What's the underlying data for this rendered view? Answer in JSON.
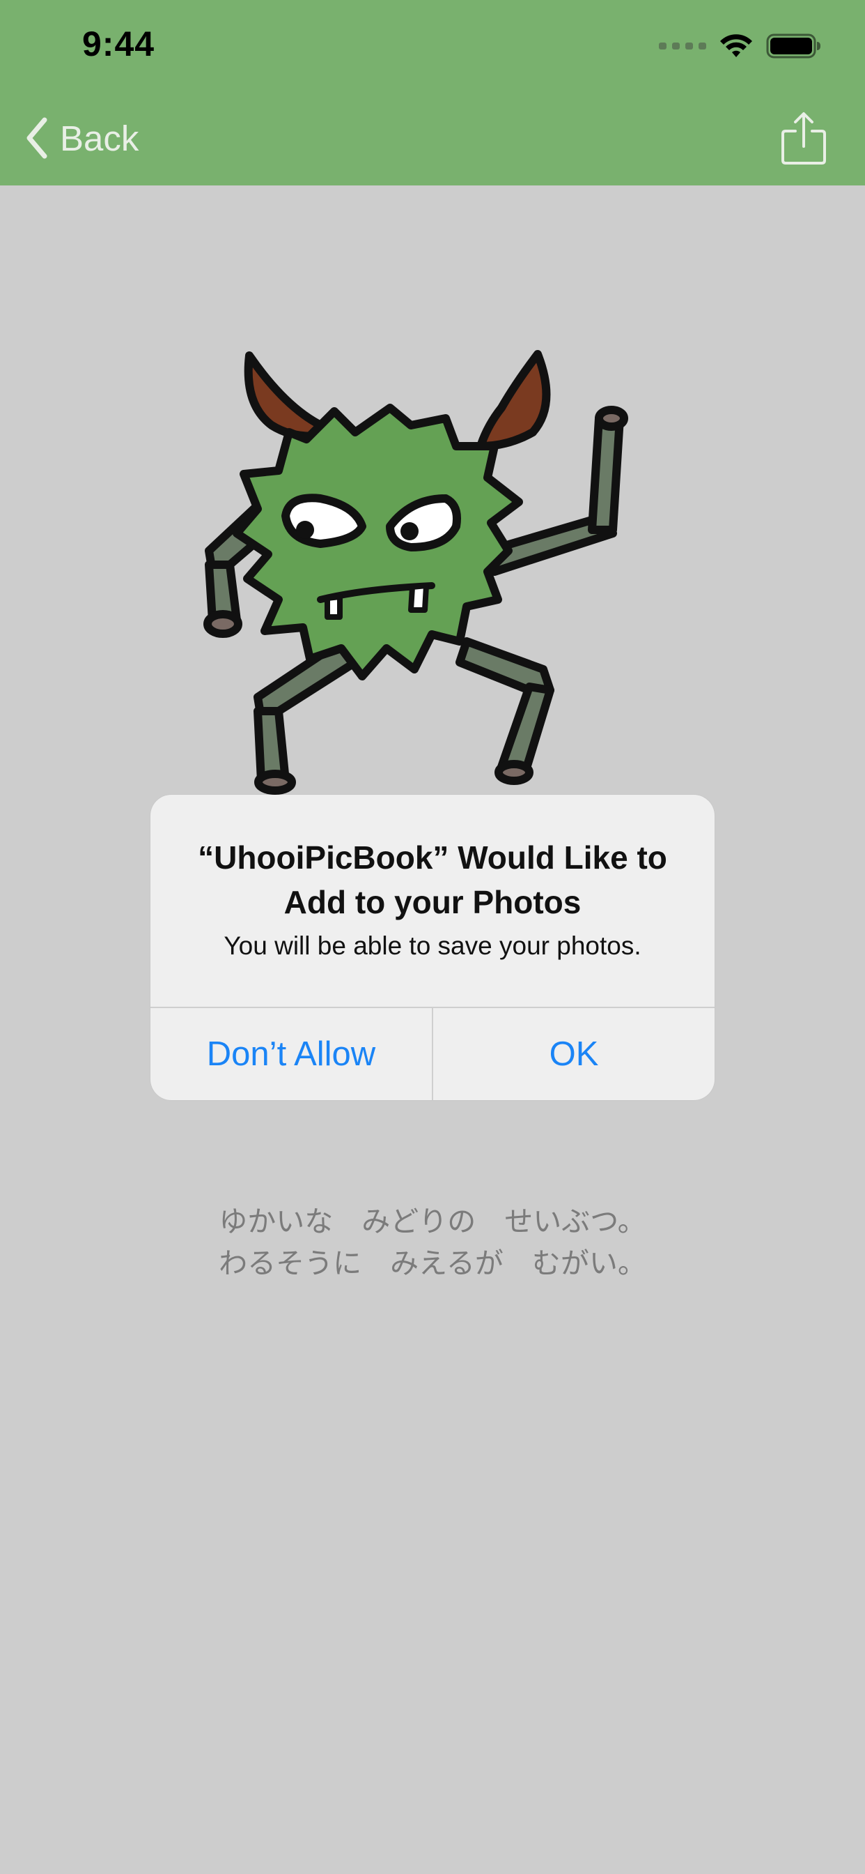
{
  "status_bar": {
    "time": "9:44"
  },
  "nav": {
    "back_label": "Back",
    "back_icon": "chevron-left-icon",
    "share_icon": "share-icon"
  },
  "alert": {
    "title": "“UhooiPicBook” Would Like to Add to your Photos",
    "message": "You will be able to save your photos.",
    "buttons": {
      "dont_allow": "Don’t Allow",
      "ok": "OK"
    }
  },
  "caption": {
    "line1": "ゆかいな　みどりの　せいぶつ。",
    "line2": "わるそうに　みえるが　むがい。"
  },
  "colors": {
    "header": "#79b16e",
    "background": "#cdcdcd",
    "accent": "#1a84f6"
  }
}
